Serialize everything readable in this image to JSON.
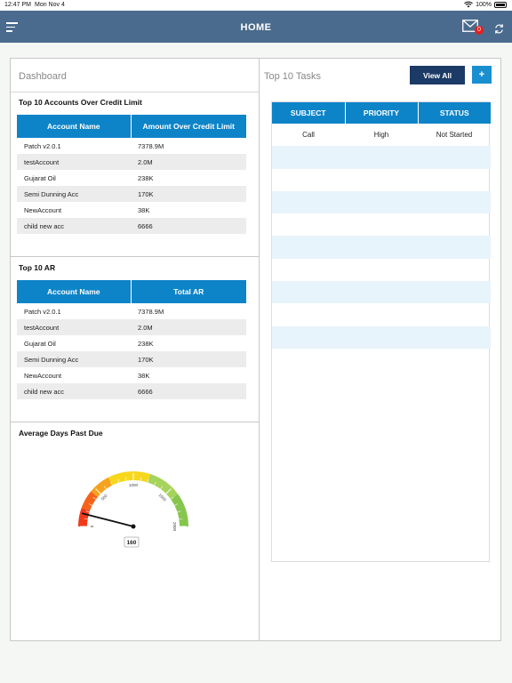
{
  "status_bar": {
    "time": "12:47 PM",
    "date": "Mon Nov 4",
    "battery": "100%"
  },
  "header": {
    "title": "HOME",
    "mail_badge": "0"
  },
  "dashboard": {
    "title": "Dashboard",
    "credit_limit": {
      "title": "Top 10 Accounts Over Credit Limit",
      "columns": [
        "Account Name",
        "Amount Over Credit Limit"
      ],
      "rows": [
        [
          "Patch v2.0.1",
          "7378.9M"
        ],
        [
          "testAccount",
          "2.0M"
        ],
        [
          "Gujarat Oil",
          "238K"
        ],
        [
          "Semi Dunning Acc",
          "170K"
        ],
        [
          "NewAccount",
          "38K"
        ],
        [
          "child new acc",
          "6666"
        ]
      ]
    },
    "top_ar": {
      "title": "Top 10 AR",
      "columns": [
        "Account Name",
        "Total AR"
      ],
      "rows": [
        [
          "Patch v2.0.1",
          "7378.9M"
        ],
        [
          "testAccount",
          "2.0M"
        ],
        [
          "Gujarat Oil",
          "238K"
        ],
        [
          "Semi Dunning Acc",
          "170K"
        ],
        [
          "NewAccount",
          "38K"
        ],
        [
          "child new acc",
          "6666"
        ]
      ]
    },
    "days_past_due": {
      "title": "Average Days Past Due",
      "gauge_value": 160,
      "gauge_value_label": "160",
      "gauge_max": 2000,
      "ticks": [
        "0",
        "500",
        "1000",
        "1500",
        "2000"
      ]
    }
  },
  "tasks": {
    "title": "Top 10 Tasks",
    "view_all_label": "View All",
    "add_label": "+",
    "columns": [
      "SUBJECT",
      "PRIORITY",
      "STATUS"
    ],
    "rows": [
      [
        "Call",
        "High",
        "Not Started"
      ]
    ]
  },
  "colors": {
    "header": "#4a6b8d",
    "table_header": "#0e84c8",
    "view_all": "#1b3a66",
    "add_button": "#1a8fd0",
    "badge": "#e02020"
  }
}
